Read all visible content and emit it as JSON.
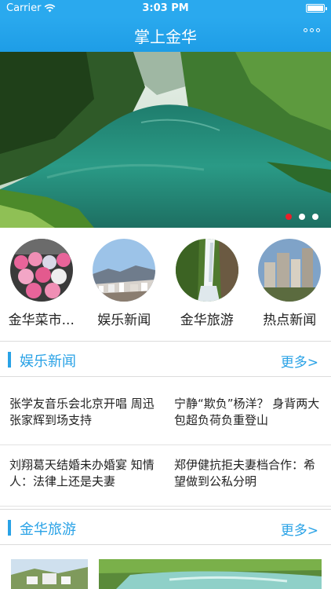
{
  "status_bar": {
    "carrier": "Carrier",
    "time": "3:03 PM",
    "wifi_icon": "wifi-icon",
    "battery_icon": "battery-icon",
    "battery_level": 1.0
  },
  "nav": {
    "title": "掌上金华",
    "more_icon": "more-icon"
  },
  "banner": {
    "image": "green-lake-valley-photo",
    "pages": 3,
    "active_page": 0,
    "dot_colors": {
      "active": "#e8202a",
      "inactive": "#ffffff"
    }
  },
  "categories": [
    {
      "label": "金华菜市...",
      "image": "market-umbrellas-photo"
    },
    {
      "label": "娱乐新闻",
      "image": "city-skyline-photo"
    },
    {
      "label": "金华旅游",
      "image": "waterfall-photo"
    },
    {
      "label": "热点新闻",
      "image": "high-rise-photo"
    }
  ],
  "entertainment": {
    "title": "娱乐新闻",
    "more": "更多>",
    "news": [
      "张学友音乐会北京开唱 周迅张家辉到场支持",
      "宁静“欺负”杨洋？ 身背两大包超负荷负重登山",
      "刘翔葛天结婚未办婚宴 知情人：法律上还是夫妻",
      "郑伊健抗拒夫妻档合作：希望做到公私分明"
    ]
  },
  "tourism": {
    "title": "金华旅游",
    "more": "更多>"
  },
  "colors": {
    "accent": "#29a2e6",
    "nav_bar": "#2aa9ee"
  }
}
